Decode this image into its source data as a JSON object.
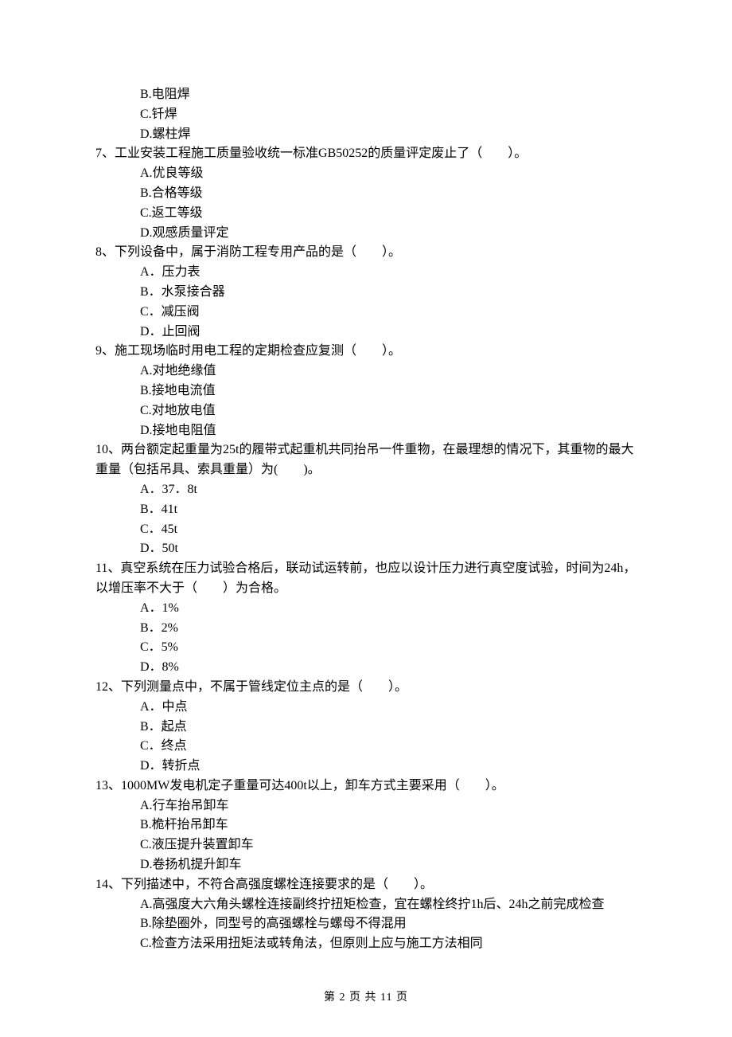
{
  "orphan_options": [
    "B.电阻焊",
    "C.钎焊",
    "D.螺柱焊"
  ],
  "questions": [
    {
      "num": "7、",
      "text": "工业安装工程施工质量验收统一标准GB50252的质量评定废止了（　　）。",
      "opts": [
        "A.优良等级",
        "B.合格等级",
        "C.返工等级",
        "D.观感质量评定"
      ]
    },
    {
      "num": "8、",
      "text": "下列设备中，属于消防工程专用产品的是（　　）。",
      "opts": [
        "A．压力表",
        "B．水泵接合器",
        "C．减压阀",
        "D．止回阀"
      ]
    },
    {
      "num": "9、",
      "text": "施工现场临时用电工程的定期检查应复测（　　）。",
      "opts": [
        "A.对地绝缘值",
        "B.接地电流值",
        "C.对地放电值",
        "D.接地电阻值"
      ]
    },
    {
      "num": "10、",
      "text": "两台额定起重量为25t的履带式起重机共同抬吊一件重物，在最理想的情况下，其重物的最大重量（包括吊具、索具重量）为(　　)。",
      "opts": [
        "A．37．8t",
        "B．41t",
        "C．45t",
        "D．50t"
      ]
    },
    {
      "num": "11、",
      "text": "真空系统在压力试验合格后，联动试运转前，也应以设计压力进行真空度试验，时间为24h，以增压率不大于（　　）为合格。",
      "opts": [
        "A．1%",
        "B．2%",
        "C．5%",
        "D．8%"
      ]
    },
    {
      "num": "12、",
      "text": "下列测量点中，不属于管线定位主点的是（　　）。",
      "opts": [
        "A．中点",
        "B．起点",
        "C．终点",
        "D．转折点"
      ]
    },
    {
      "num": "13、",
      "text": "1000MW发电机定子重量可达400t以上，卸车方式主要采用（　　）。",
      "opts": [
        "A.行车抬吊卸车",
        "B.桅杆抬吊卸车",
        "C.液压提升装置卸车",
        "D.卷扬机提升卸车"
      ]
    },
    {
      "num": "14、",
      "text": "下列描述中，不符合高强度螺栓连接要求的是（　　）。",
      "opts": [
        "A.高强度大六角头螺栓连接副终拧扭矩检查，宜在螺栓终拧1h后、24h之前完成检查",
        "B.除垫圈外，同型号的高强螺栓与螺母不得混用",
        "C.检查方法采用扭矩法或转角法，但原则上应与施工方法相同"
      ]
    }
  ],
  "footer": "第 2 页 共 11 页"
}
